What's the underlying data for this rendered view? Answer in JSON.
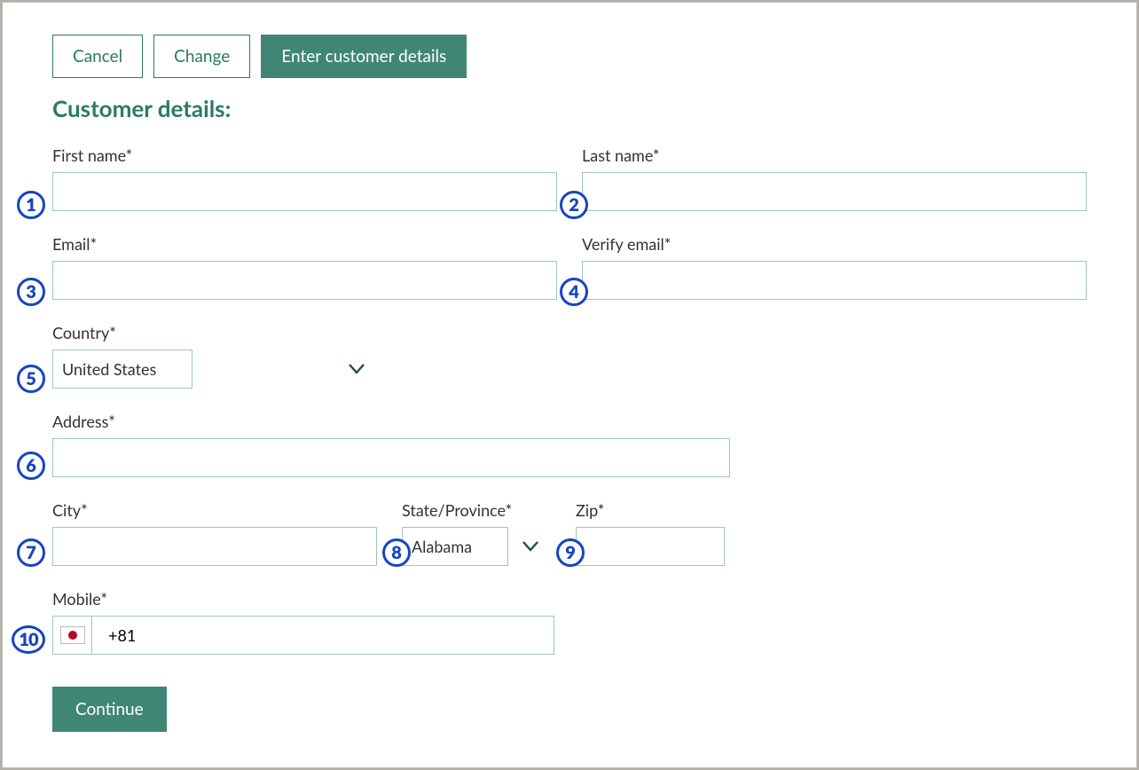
{
  "topButtons": {
    "cancel": "Cancel",
    "change": "Change",
    "enter": "Enter customer details"
  },
  "sectionTitle": "Customer details:",
  "fields": {
    "firstName": {
      "label": "First name*",
      "value": ""
    },
    "lastName": {
      "label": "Last name*",
      "value": ""
    },
    "email": {
      "label": "Email*",
      "value": ""
    },
    "verifyEmail": {
      "label": "Verify email*",
      "value": ""
    },
    "country": {
      "label": "Country*",
      "value": "United States"
    },
    "address": {
      "label": "Address*",
      "value": ""
    },
    "city": {
      "label": "City*",
      "value": ""
    },
    "state": {
      "label": "State/Province*",
      "value": "Alabama"
    },
    "zip": {
      "label": "Zip*",
      "value": ""
    },
    "mobile": {
      "label": "Mobile*",
      "value": "+81"
    }
  },
  "continue": "Continue",
  "markers": {
    "m1": "1",
    "m2": "2",
    "m3": "3",
    "m4": "4",
    "m5": "5",
    "m6": "6",
    "m7": "7",
    "m8": "8",
    "m9": "9",
    "m10": "10"
  }
}
